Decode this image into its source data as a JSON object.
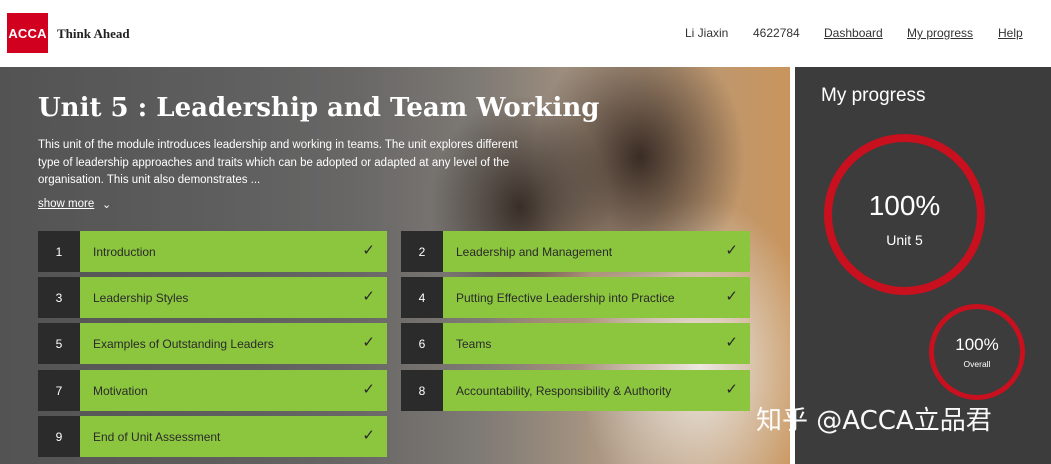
{
  "header": {
    "logo_text": "ACCA",
    "tagline": "Think Ahead",
    "user_name": "Li Jiaxin",
    "user_id": "4622784",
    "nav": {
      "dashboard": "Dashboard",
      "my_progress": "My progress",
      "help": "Help"
    }
  },
  "hero": {
    "title": "Unit 5 : Leadership and Team Working",
    "description": "This unit of the module introduces leadership and working in teams. The unit explores different type of leadership approaches and traits which can be adopted or adapted at any level of the organisation. This unit also demonstrates ...",
    "show_more": "show more",
    "show_more_icon": "chevron-down-icon"
  },
  "units": [
    {
      "num": "1",
      "label": "Introduction",
      "completed": true
    },
    {
      "num": "2",
      "label": "Leadership and Management",
      "completed": true
    },
    {
      "num": "3",
      "label": "Leadership Styles",
      "completed": true
    },
    {
      "num": "4",
      "label": "Putting Effective Leadership into Practice",
      "completed": true
    },
    {
      "num": "5",
      "label": "Examples of Outstanding Leaders",
      "completed": true
    },
    {
      "num": "6",
      "label": "Teams",
      "completed": true
    },
    {
      "num": "7",
      "label": "Motivation",
      "completed": true
    },
    {
      "num": "8",
      "label": "Accountability, Responsibility & Authority",
      "completed": true
    },
    {
      "num": "9",
      "label": "End of Unit Assessment",
      "completed": true
    }
  ],
  "progress": {
    "title": "My progress",
    "unit": {
      "percent": "100%",
      "label": "Unit 5",
      "value": 1.0
    },
    "overall": {
      "percent": "100%",
      "label": "Overall",
      "value": 1.0
    }
  },
  "watermark": "知乎 @ACCA立品君",
  "colors": {
    "brand_red": "#d2001f",
    "ring_red": "#c8101e",
    "completed_green": "#8cc63f",
    "number_bg": "#2b2b2b",
    "panel_bg": "#3c3c3c"
  }
}
